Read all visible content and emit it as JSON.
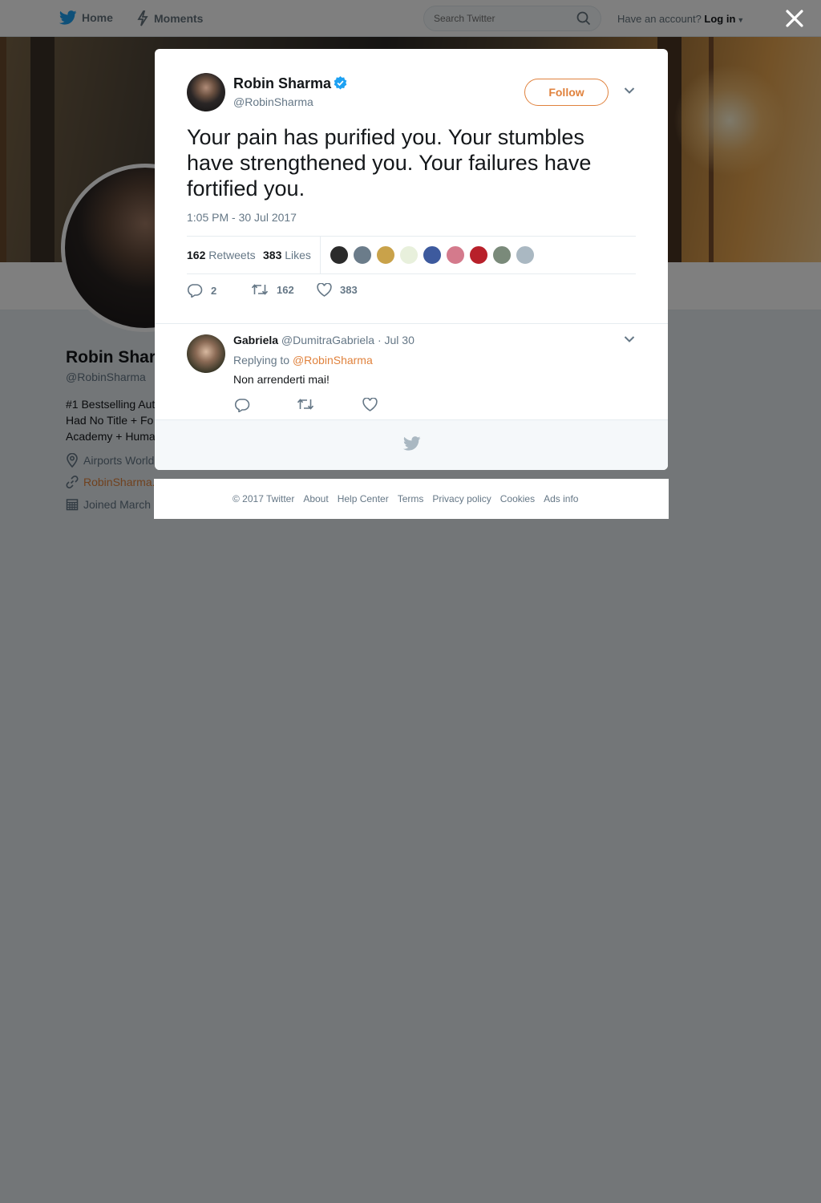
{
  "nav": {
    "home_label": "Home",
    "moments_label": "Moments",
    "search_placeholder": "Search Twitter",
    "login_prompt": "Have an account?",
    "login_label": "Log in"
  },
  "profile": {
    "name": "Robin Sharma",
    "handle": "@RobinSharma",
    "bio_lines": [
      "#1 Bestselling Aut",
      "Had No Title + Fo",
      "Academy + Huma"
    ],
    "location": "Airports World",
    "website": "RobinSharma.",
    "joined": "Joined March"
  },
  "tweet": {
    "author_name": "Robin Sharma",
    "author_handle": "@RobinSharma",
    "verified": true,
    "follow_label": "Follow",
    "text": "Your pain has purified you. Your stumbles have strengthened you. Your failures have fortified you.",
    "timestamp": "1:05 PM - 30 Jul 2017",
    "retweets_count": "162",
    "retweets_label": "Retweets",
    "likes_count": "383",
    "likes_label": "Likes",
    "likers": [
      "#2b2b2b",
      "#6b7c8a",
      "#c9a24a",
      "#e8f0dc",
      "#3d5a9e",
      "#d47a8c",
      "#b8202a",
      "#7a8a7a",
      "#aab8c2"
    ],
    "reply_count": "2",
    "retweet_count": "162",
    "like_count": "383"
  },
  "reply": {
    "author_name": "Gabriela",
    "author_handle": "@DumitraGabriela",
    "date": "· Jul 30",
    "replying_prefix": "Replying to",
    "replying_to": "@RobinSharma",
    "text": "Non arrenderti mai!"
  },
  "footer": {
    "links": [
      "© 2017 Twitter",
      "About",
      "Help Center",
      "Terms",
      "Privacy policy",
      "Cookies",
      "Ads info"
    ]
  },
  "colors": {
    "accent": "#e0823d",
    "verified": "#1da1f2",
    "secondary_text": "#657786"
  }
}
